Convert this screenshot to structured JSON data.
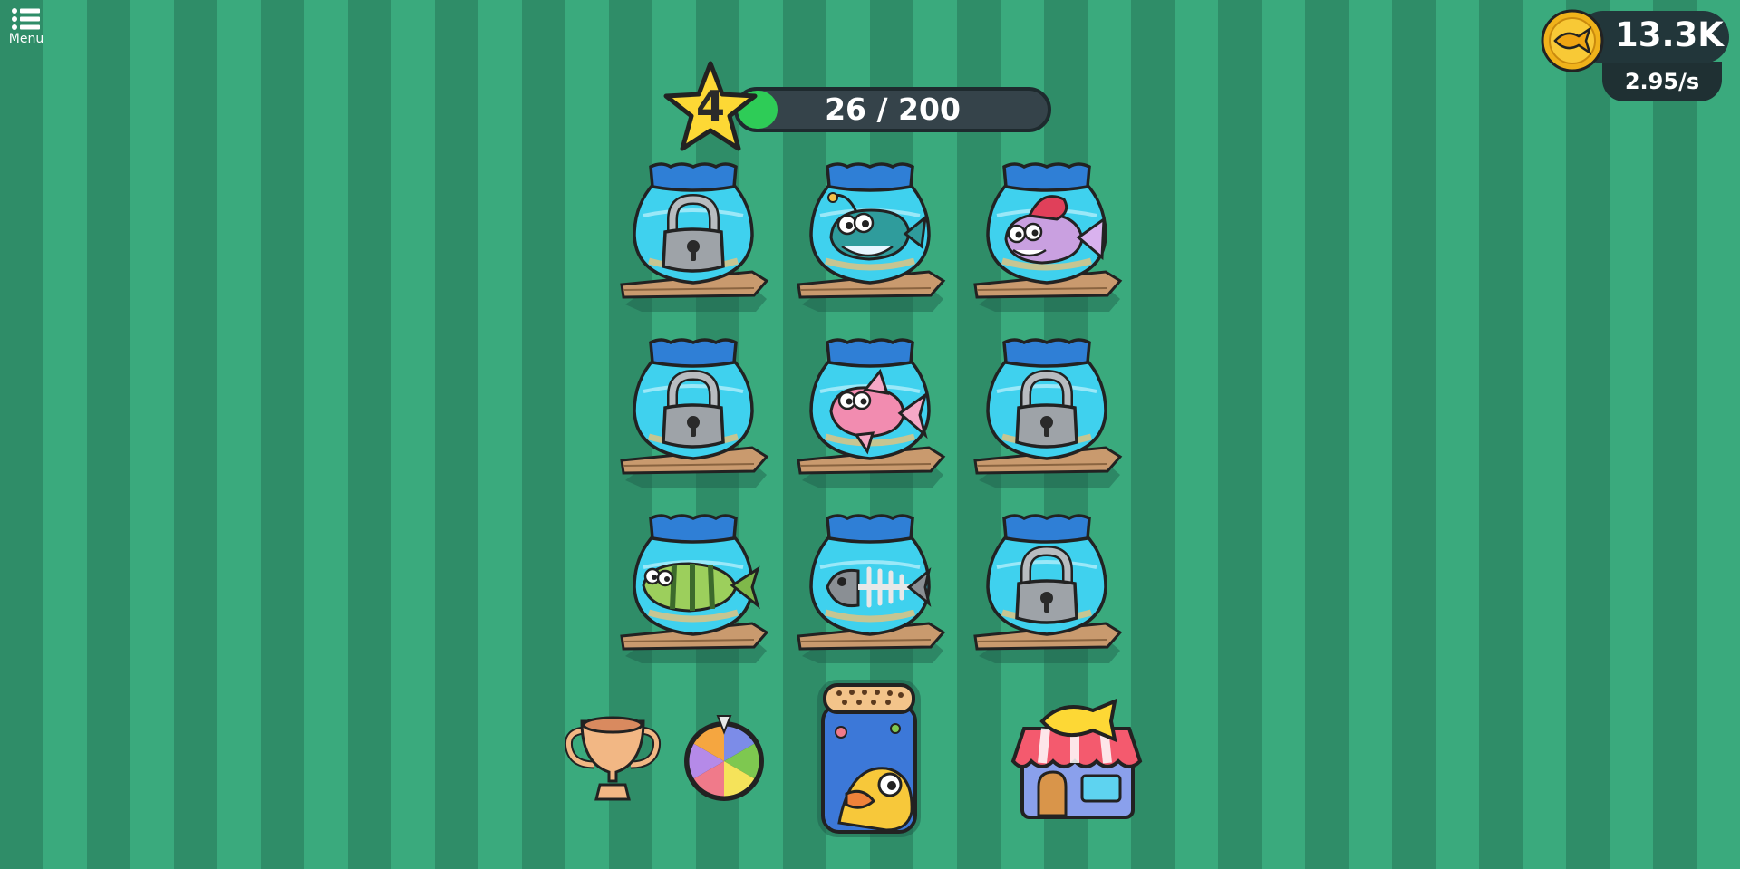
{
  "menu": {
    "label": "Menu",
    "icon": "list-icon"
  },
  "currency": {
    "amount": "13.3K",
    "rate": "2.95/s",
    "icon": "gold-fish-coin-icon"
  },
  "level": {
    "number": "4",
    "xp_text": "26 / 200",
    "progress": 0.13
  },
  "bowls": [
    {
      "slot": 1,
      "state": "locked",
      "icon": "lock-icon"
    },
    {
      "slot": 2,
      "state": "fish",
      "icon": "anglerfish-icon"
    },
    {
      "slot": 3,
      "state": "fish",
      "icon": "pink-mohawk-fish-icon"
    },
    {
      "slot": 4,
      "state": "locked",
      "icon": "lock-icon"
    },
    {
      "slot": 5,
      "state": "fish",
      "icon": "pink-fish-icon"
    },
    {
      "slot": 6,
      "state": "locked",
      "icon": "lock-icon"
    },
    {
      "slot": 7,
      "state": "fish",
      "icon": "green-striped-fish-icon"
    },
    {
      "slot": 8,
      "state": "fish",
      "icon": "fish-skeleton-icon"
    },
    {
      "slot": 9,
      "state": "locked",
      "icon": "lock-icon"
    }
  ],
  "bottom": {
    "trophy": "trophy-icon",
    "wheel": "prize-wheel-icon",
    "food": "fish-food-jar-icon",
    "shop": "fish-shop-icon"
  },
  "colors": {
    "stripe_dark": "#2f8d68",
    "stripe_light": "#3aaa7d",
    "xp_fill": "#2ecc57",
    "bowl_water": "#3fd1ee"
  }
}
